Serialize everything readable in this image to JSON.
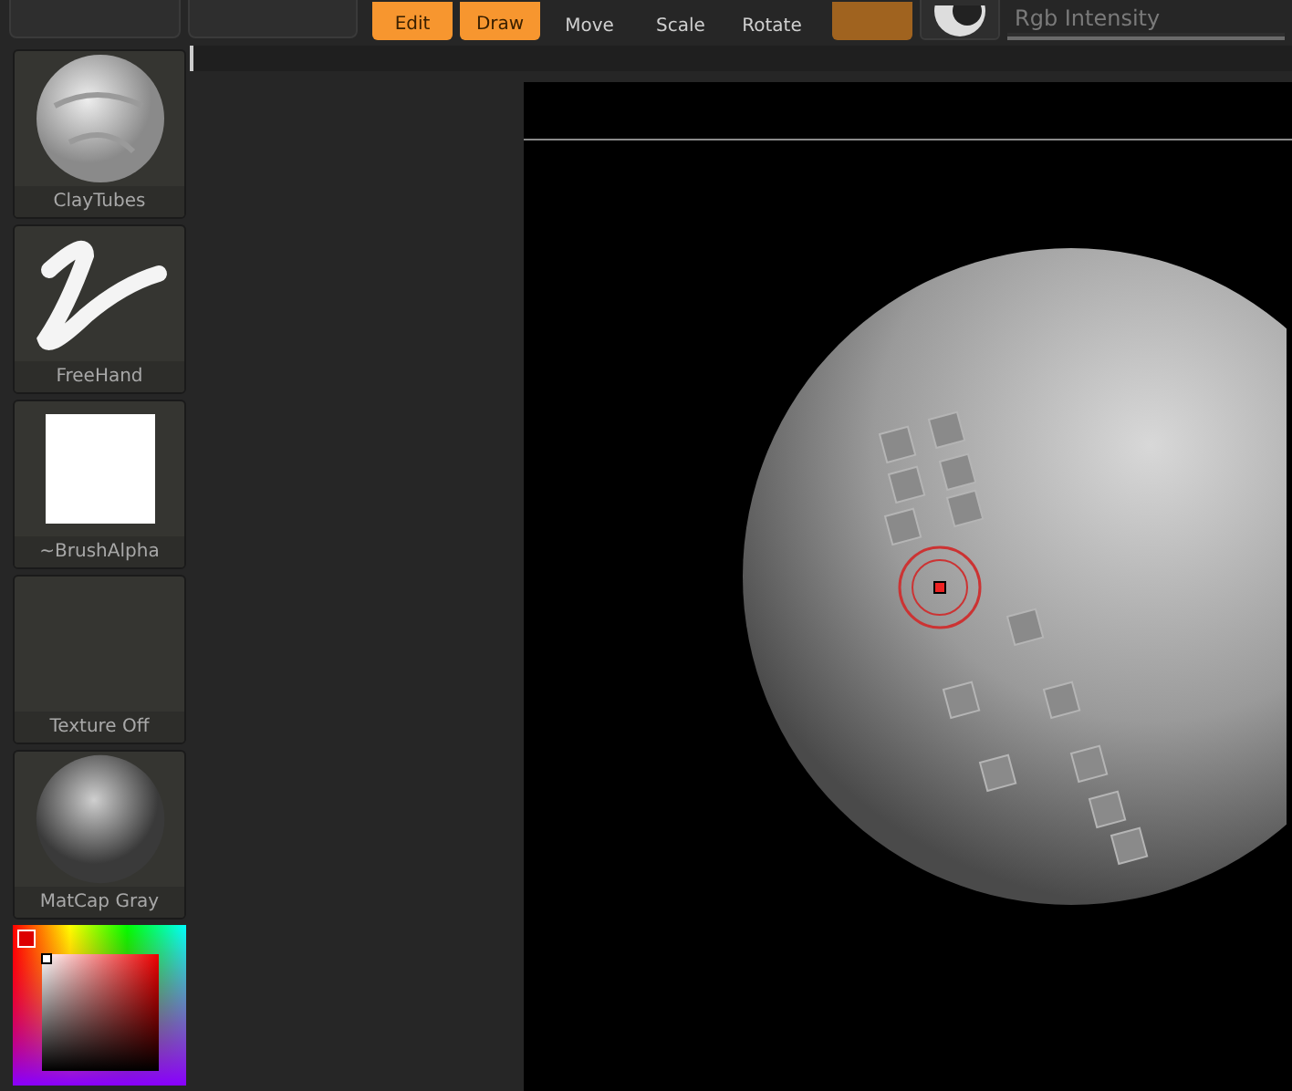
{
  "toolbar": {
    "modes": [
      {
        "label": "Edit",
        "selected": true
      },
      {
        "label": "Draw",
        "selected": true
      }
    ],
    "transforms": [
      {
        "label": "Move",
        "selected": false
      },
      {
        "label": "Scale",
        "selected": false
      },
      {
        "label": "Rotate",
        "selected": false
      }
    ],
    "slider": {
      "label": "Rgb Intensity",
      "level": 1
    }
  },
  "tiles": [
    {
      "label": "ClayTubes",
      "kind": "brush"
    },
    {
      "label": "FreeHand",
      "kind": "stroke"
    },
    {
      "label": "~BrushAlpha",
      "kind": "alpha"
    },
    {
      "label": "Texture Off",
      "kind": "texture"
    },
    {
      "label": "MatCap Gray",
      "kind": "material"
    }
  ]
}
